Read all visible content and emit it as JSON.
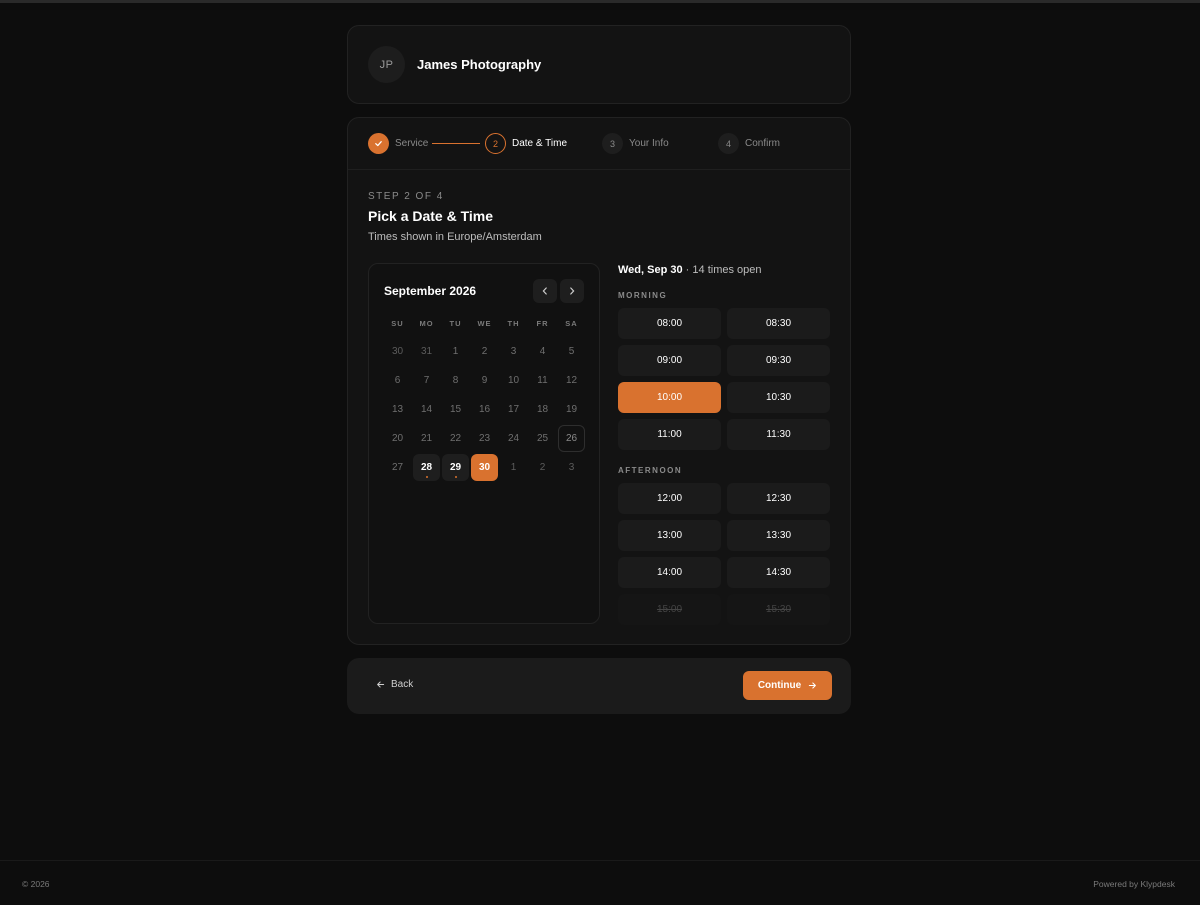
{
  "business": {
    "initials": "JP",
    "name": "James Photography"
  },
  "steps": [
    {
      "number": "1",
      "label": "Service",
      "state": "done"
    },
    {
      "number": "2",
      "label": "Date & Time",
      "state": "active"
    },
    {
      "number": "3",
      "label": "Your Info",
      "state": "pending"
    },
    {
      "number": "4",
      "label": "Confirm",
      "state": "pending"
    }
  ],
  "content": {
    "eyebrow": "STEP 2 OF 4",
    "title": "Pick a Date & Time",
    "timezone": "Times shown in Europe/Amsterdam"
  },
  "calendar": {
    "month_label": "September 2026",
    "weekdays": [
      "SU",
      "MO",
      "TU",
      "WE",
      "TH",
      "FR",
      "SA"
    ],
    "days": [
      {
        "d": "30",
        "s": "other"
      },
      {
        "d": "31",
        "s": "other"
      },
      {
        "d": "1",
        "s": ""
      },
      {
        "d": "2",
        "s": ""
      },
      {
        "d": "3",
        "s": ""
      },
      {
        "d": "4",
        "s": ""
      },
      {
        "d": "5",
        "s": ""
      },
      {
        "d": "6",
        "s": ""
      },
      {
        "d": "7",
        "s": ""
      },
      {
        "d": "8",
        "s": ""
      },
      {
        "d": "9",
        "s": ""
      },
      {
        "d": "10",
        "s": ""
      },
      {
        "d": "11",
        "s": ""
      },
      {
        "d": "12",
        "s": ""
      },
      {
        "d": "13",
        "s": ""
      },
      {
        "d": "14",
        "s": ""
      },
      {
        "d": "15",
        "s": ""
      },
      {
        "d": "16",
        "s": ""
      },
      {
        "d": "17",
        "s": ""
      },
      {
        "d": "18",
        "s": ""
      },
      {
        "d": "19",
        "s": ""
      },
      {
        "d": "20",
        "s": ""
      },
      {
        "d": "21",
        "s": ""
      },
      {
        "d": "22",
        "s": ""
      },
      {
        "d": "23",
        "s": ""
      },
      {
        "d": "24",
        "s": ""
      },
      {
        "d": "25",
        "s": ""
      },
      {
        "d": "26",
        "s": "today"
      },
      {
        "d": "27",
        "s": ""
      },
      {
        "d": "28",
        "s": "avail"
      },
      {
        "d": "29",
        "s": "avail"
      },
      {
        "d": "30",
        "s": "sel"
      },
      {
        "d": "1",
        "s": "other"
      },
      {
        "d": "2",
        "s": "other"
      },
      {
        "d": "3",
        "s": "other"
      }
    ]
  },
  "slots": {
    "date_label": "Wed, Sep 30",
    "separator": "·",
    "count_label": "14 times open",
    "morning_label": "MORNING",
    "afternoon_label": "AFTERNOON",
    "morning": [
      {
        "t": "08:00",
        "s": ""
      },
      {
        "t": "08:30",
        "s": ""
      },
      {
        "t": "09:00",
        "s": ""
      },
      {
        "t": "09:30",
        "s": ""
      },
      {
        "t": "10:00",
        "s": "sel"
      },
      {
        "t": "10:30",
        "s": ""
      },
      {
        "t": "11:00",
        "s": ""
      },
      {
        "t": "11:30",
        "s": ""
      }
    ],
    "afternoon": [
      {
        "t": "12:00",
        "s": ""
      },
      {
        "t": "12:30",
        "s": ""
      },
      {
        "t": "13:00",
        "s": ""
      },
      {
        "t": "13:30",
        "s": ""
      },
      {
        "t": "14:00",
        "s": ""
      },
      {
        "t": "14:30",
        "s": ""
      },
      {
        "t": "15:00",
        "s": "dis"
      },
      {
        "t": "15:30",
        "s": "dis"
      }
    ]
  },
  "actions": {
    "back_label": "Back",
    "continue_label": "Continue"
  },
  "footer": {
    "copyright": "© 2026",
    "powered": "Powered by Klypdesk"
  },
  "colors": {
    "accent": "#d9722f",
    "background": "#0d0d0d",
    "card": "#131313"
  }
}
